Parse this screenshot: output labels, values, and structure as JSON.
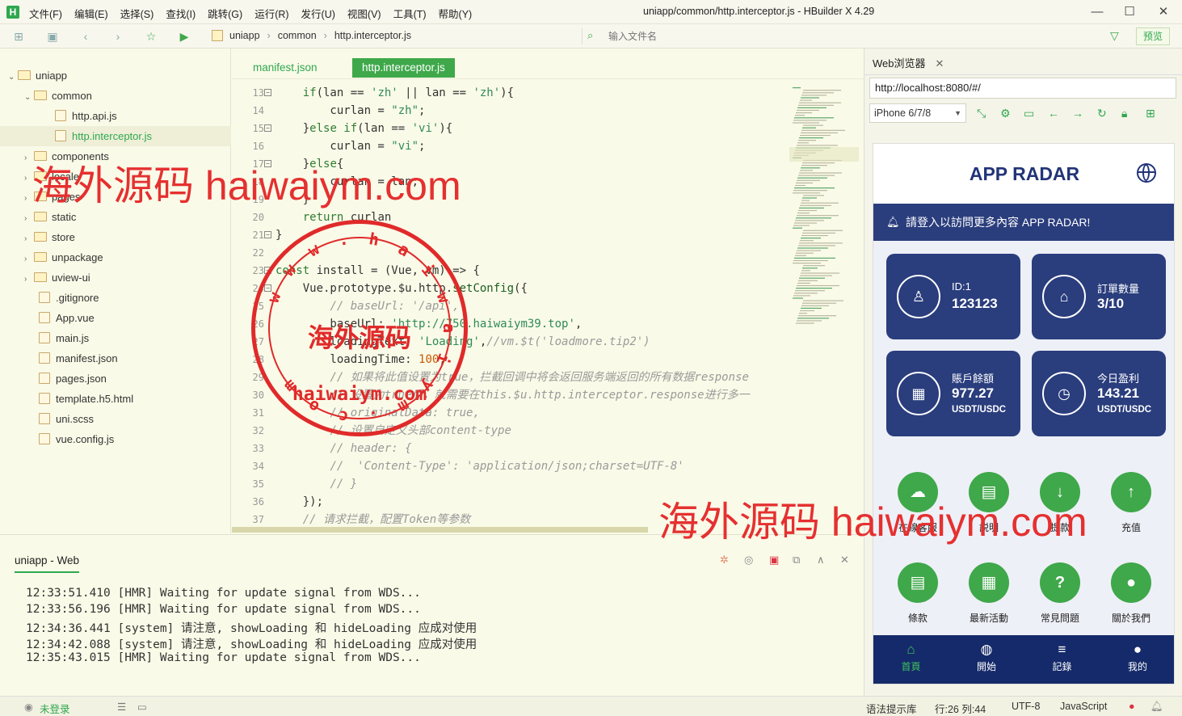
{
  "app": {
    "window_title": "uniapp/common/http.interceptor.js - HBuilder X 4.29",
    "logo": "H",
    "menu": [
      "文件(F)",
      "编辑(E)",
      "选择(S)",
      "查找(I)",
      "跳转(G)",
      "运行(R)",
      "发行(U)",
      "视图(V)",
      "工具(T)",
      "帮助(Y)"
    ]
  },
  "toolbar": {
    "breadcrumb": [
      "uniapp",
      "common",
      "http.interceptor.js"
    ],
    "file_input_placeholder": "输入文件名",
    "preview_label": "预览"
  },
  "sidebar": {
    "items": [
      {
        "label": "uniapp",
        "kind": "folder",
        "open": true
      },
      {
        "label": "common",
        "kind": "folder",
        "open": true
      },
      {
        "label": "http.api.js",
        "kind": "file"
      },
      {
        "label": "http.interceptor.js",
        "kind": "file",
        "selected": true
      },
      {
        "label": "components",
        "kind": "folder"
      },
      {
        "label": "locale",
        "kind": "folder"
      },
      {
        "label": "pages",
        "kind": "folder"
      },
      {
        "label": "static",
        "kind": "folder"
      },
      {
        "label": "store",
        "kind": "folder"
      },
      {
        "label": "unpackage",
        "kind": "folder"
      },
      {
        "label": "uview-ui",
        "kind": "folder"
      },
      {
        "label": ".gitignore",
        "kind": "file"
      },
      {
        "label": "App.vue",
        "kind": "file"
      },
      {
        "label": "main.js",
        "kind": "file"
      },
      {
        "label": "manifest.json",
        "kind": "file"
      },
      {
        "label": "pages.json",
        "kind": "file"
      },
      {
        "label": "template.h5.html",
        "kind": "file"
      },
      {
        "label": "uni.scss",
        "kind": "file"
      },
      {
        "label": "vue.config.js",
        "kind": "file"
      }
    ]
  },
  "editor": {
    "tabs": [
      {
        "label": "manifest.json",
        "active": false
      },
      {
        "label": "http.interceptor.js",
        "active": true
      }
    ],
    "lines": [
      {
        "n": "13",
        "fold": "−",
        "html": "    <span class=\"kw\">if</span>(lan == <span class=\"str\">'zh'</span> || lan == <span class=\"str\">'zh'</span>){"
      },
      {
        "n": "14",
        "html": "        curlan = <span class=\"str\">\"zh\"</span>;"
      },
      {
        "n": "15",
        "fold": "−",
        "html": "    }<span class=\"kw\">else if</span>(lan == <span class=\"str\">'vi'</span>){"
      },
      {
        "n": "16",
        "html": "        curlan = <span class=\"str\">\"vi\"</span>;"
      },
      {
        "n": "17",
        "fold": "−",
        "html": "    }<span class=\"kw\">else</span>{"
      },
      {
        "n": "18",
        "html": "        curlan = lan;"
      },
      {
        "n": "19",
        "html": "    }"
      },
      {
        "n": "20",
        "html": "    <span class=\"kw\">return</span> curlan"
      },
      {
        "n": "21",
        "fold": "−",
        "html": "}"
      },
      {
        "n": "22",
        "html": ""
      },
      {
        "n": "23",
        "fold": "−",
        "html": "<span class=\"kw\">const</span> install = (Vue, vm) => {"
      },
      {
        "n": "24",
        "fold": "−",
        "html": "    Vue.prototype.$u.http.<span class=\"fn\">setConfig</span>({"
      },
      {
        "n": "25",
        "html": "        <span class=\"cm\">// baseUrl: '/api',</span>"
      },
      {
        "n": "26",
        "html": "        baseUrl: <span class=\"str\">'http://750.haiwaiym39.top'</span>,"
      },
      {
        "n": "27",
        "html": "        loadingText: <span class=\"str\">'Loading'</span>,<span class=\"cm\">//vm.$t('loadmore.tip2')</span>"
      },
      {
        "n": "28",
        "html": "        loadingTime: <span class=\"num\">100</span>,"
      },
      {
        "n": "29",
        "html": "        <span class=\"cm\">// 如果将此值设置为true，拦截回调中将会返回服务端返回的所有数据response</span>"
      },
      {
        "n": "30",
        "html": "        <span class=\"cm\">// 设置为true后，就需要在this.$u.http.interceptor.response进行多一</span>"
      },
      {
        "n": "31",
        "html": "        <span class=\"cm\">// originalData: true,</span>"
      },
      {
        "n": "32",
        "html": "        <span class=\"cm\">// 设置自定义头部content-type</span>"
      },
      {
        "n": "33",
        "html": "        <span class=\"cm\">// header: {</span>"
      },
      {
        "n": "34",
        "html": "        <span class=\"cm\">//  'Content-Type': 'application/json;charset=UTF-8'</span>"
      },
      {
        "n": "35",
        "html": "        <span class=\"cm\">// }</span>"
      },
      {
        "n": "36",
        "html": "    });"
      },
      {
        "n": "37",
        "html": "    <span class=\"cm\">// 请求拦截，配置Token等参数</span>"
      }
    ]
  },
  "console": {
    "tab": "uniapp - Web",
    "logs": [
      "12:33:51.410 [HMR] Waiting for update signal from WDS...",
      "12:33:56.196 [HMR] Waiting for update signal from WDS...",
      "12:34:36.441 [system] 请注意, showLoading 和 hideLoading 应成对使用",
      "12:34:42.088 [system] 请注意, showLoading 和 hideLoading 应成对使用",
      "12:35:43.015 [HMR] Waiting for update signal from WDS..."
    ]
  },
  "browser": {
    "tab": "Web浏览器",
    "url": "http://localhost:8080/#/",
    "device": "iPhone 6/7/8"
  },
  "app_preview": {
    "title": "APP RADAR",
    "notice": "請登入以訪問更多內容 APP RADAR!",
    "cards": [
      {
        "label": "ID:1",
        "value": "123123",
        "unit": "",
        "icon": "user-icon"
      },
      {
        "label": "訂單數量",
        "value": "3/10",
        "unit": "",
        "icon": "bag-icon"
      },
      {
        "label": "賬戶餘額",
        "value": "977.27",
        "unit": "USDT/USDC",
        "icon": "grid-icon"
      },
      {
        "label": "今日盈利",
        "value": "143.21",
        "unit": "USDT/USDC",
        "icon": "clock-icon"
      }
    ],
    "actions": [
      {
        "label": "在線客服",
        "icon": "chat-icon"
      },
      {
        "label": "説明",
        "icon": "doc-icon"
      },
      {
        "label": "提款",
        "icon": "arrow-down-icon"
      },
      {
        "label": "充值",
        "icon": "arrow-up-icon"
      },
      {
        "label": "條款",
        "icon": "file-icon"
      },
      {
        "label": "最新活動",
        "icon": "calendar-icon"
      },
      {
        "label": "常見問題",
        "icon": "question-icon"
      },
      {
        "label": "關於我們",
        "icon": "person-icon"
      }
    ],
    "nav": [
      {
        "label": "首頁",
        "icon": "home-icon",
        "active": true
      },
      {
        "label": "開始",
        "icon": "globe-icon"
      },
      {
        "label": "記錄",
        "icon": "menu-icon"
      },
      {
        "label": "我的",
        "icon": "profile-icon"
      }
    ]
  },
  "status": {
    "login": "未登录",
    "hint": "语法提示库",
    "position": "行:26  列:44",
    "encoding": "UTF-8",
    "language": "JavaScript"
  },
  "watermarks": {
    "text1": "海外源码 haiwaiym.com",
    "text2": "海外源码 haiwaiym.com",
    "stamp_center": "海外源码",
    "stamp_domain": "haiwaiym.com",
    "stamp_ring": "www.haiwaiym.com"
  },
  "colors": {
    "accent": "#2fa84f",
    "navy": "#2a3d7d",
    "stamp": "#e02a2a"
  }
}
